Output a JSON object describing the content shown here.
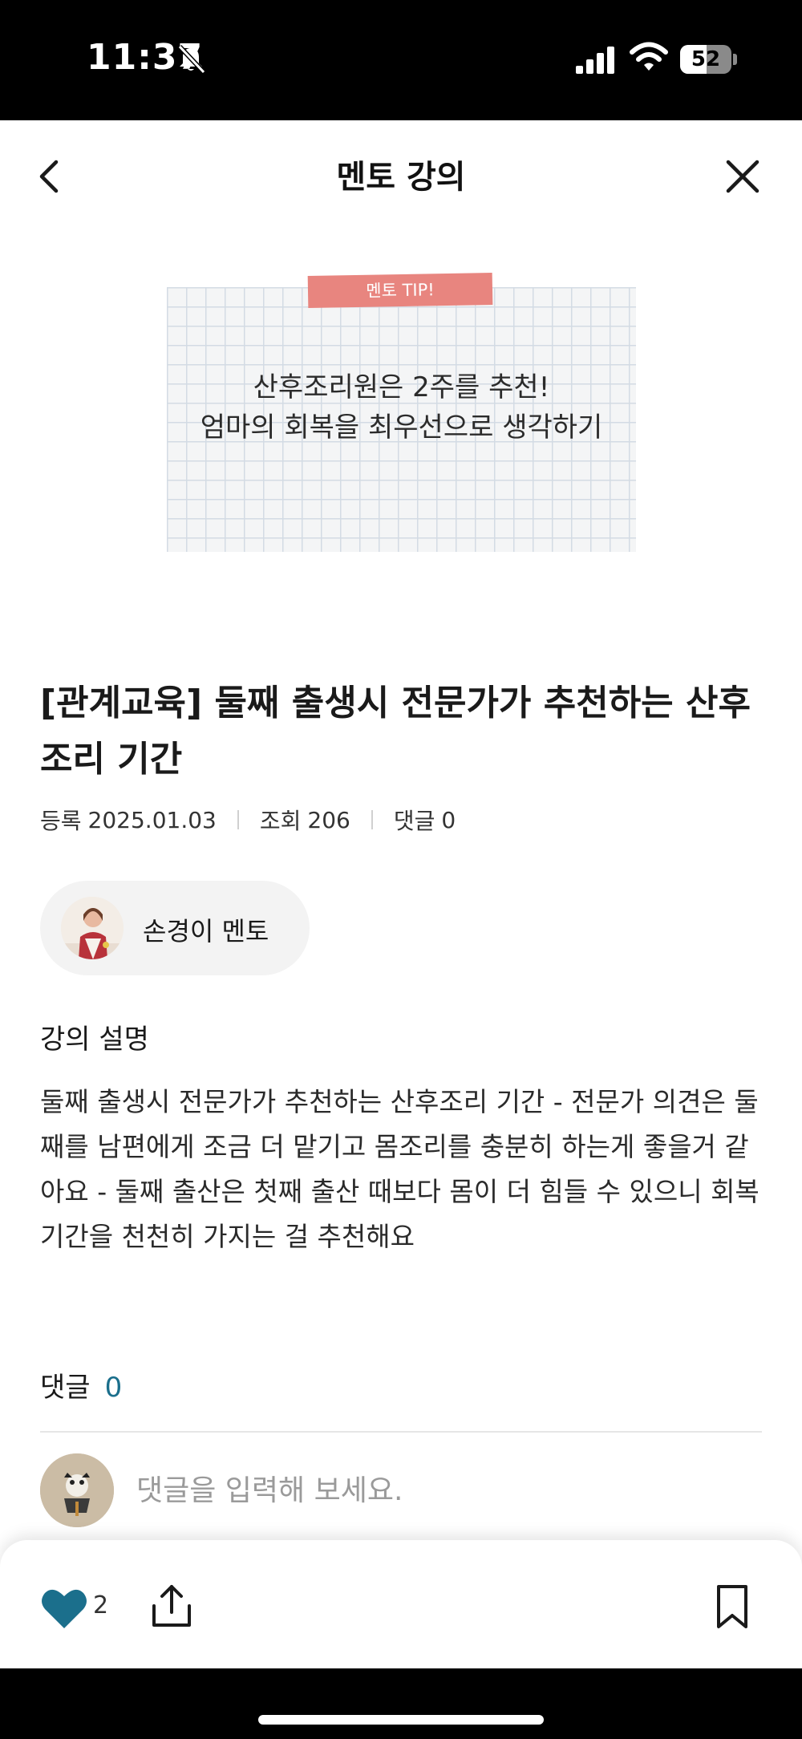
{
  "status_bar": {
    "time": "11:37",
    "battery": "52",
    "battery_level": 0.52
  },
  "nav": {
    "title": "멘토 강의"
  },
  "thumbnail": {
    "tag": "멘토 TIP!",
    "line1": "산후조리원은 2주를 추천!",
    "line2": "엄마의 회복을 최우선으로 생각하기"
  },
  "article": {
    "title": "[관계교육] 둘째 출생시 전문가가 추천하는 산후조리 기간",
    "meta": {
      "registered_label": "등록",
      "registered_value": "2025.01.03",
      "views_label": "조회",
      "views_value": "206",
      "comments_label": "댓글",
      "comments_value": "0"
    }
  },
  "mentor": {
    "name": "손경이 멘토"
  },
  "description": {
    "label": "강의 설명",
    "text": "둘째 출생시 전문가가 추천하는 산후조리 기간 - 전문가 의견은 둘째를 남편에게 조금 더 맡기고 몸조리를 충분히 하는게 좋을거 같아요 - 둘째 출산은 첫째 출산 때보다 몸이 더 힘들 수 있으니 회복 기간을 천천히 가지는 걸 추천해요"
  },
  "comments": {
    "label": "댓글",
    "count": "0",
    "placeholder": "댓글을 입력해 보세요."
  },
  "bottom_bar": {
    "like_count": "2"
  },
  "colors": {
    "accent": "#1b6f8c",
    "tag": "#e8857f"
  },
  "icons": [
    "bell-slash-icon",
    "signal-icon",
    "wifi-icon",
    "back-chevron-icon",
    "close-icon",
    "heart-icon",
    "share-icon",
    "bookmark-icon"
  ]
}
